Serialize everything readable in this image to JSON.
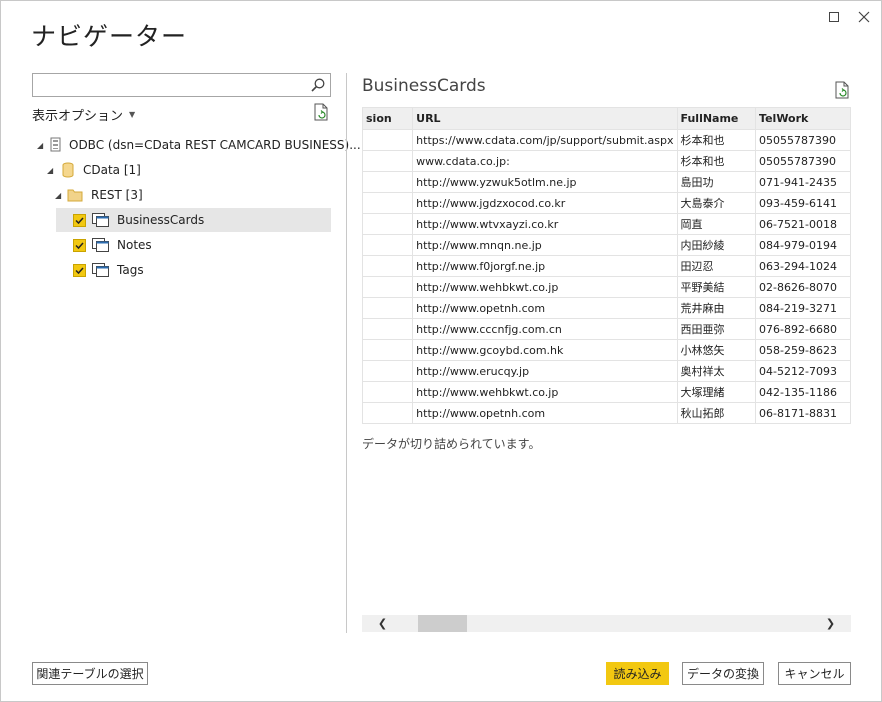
{
  "window": {
    "title": "ナビゲーター",
    "maximize_icon": "maximize-icon",
    "close_icon": "close-icon"
  },
  "left": {
    "search": {
      "value": "",
      "placeholder": ""
    },
    "display_options_label": "表示オプション",
    "tree": [
      {
        "label": "ODBC (dsn=CData REST CAMCARD BUSINESS)...",
        "icon": "database-server-icon",
        "expanded": true
      },
      {
        "label": "CData [1]",
        "icon": "cylinder-database-icon",
        "expanded": true
      },
      {
        "label": "REST [3]",
        "icon": "folder-icon",
        "expanded": true
      },
      {
        "label": "BusinessCards",
        "icon": "table-icon",
        "checked": true,
        "selected": true
      },
      {
        "label": "Notes",
        "icon": "table-icon",
        "checked": true
      },
      {
        "label": "Tags",
        "icon": "table-icon",
        "checked": true
      }
    ]
  },
  "preview": {
    "title": "BusinessCards",
    "columns": [
      "sion",
      "URL",
      "FullName",
      "TelWork"
    ],
    "rows": [
      [
        "",
        "https://www.cdata.com/jp/support/submit.aspx",
        "杉本和也",
        "05055787390"
      ],
      [
        "",
        "www.cdata.co.jp:",
        "杉本和也",
        "05055787390"
      ],
      [
        "",
        "http://www.yzwuk5otlm.ne.jp",
        "島田功",
        "071-941-2435"
      ],
      [
        "",
        "http://www.jgdzxocod.co.kr",
        "大島泰介",
        "093-459-6141"
      ],
      [
        "",
        "http://www.wtvxayzi.co.kr",
        "岡直",
        "06-7521-0018"
      ],
      [
        "",
        "http://www.mnqn.ne.jp",
        "内田紗綾",
        "084-979-0194"
      ],
      [
        "",
        "http://www.f0jorgf.ne.jp",
        "田辺忍",
        "063-294-1024"
      ],
      [
        "",
        "http://www.wehbkwt.co.jp",
        "平野美結",
        "02-8626-8070"
      ],
      [
        "",
        "http://www.opetnh.com",
        "荒井麻由",
        "084-219-3271"
      ],
      [
        "",
        "http://www.cccnfjg.com.cn",
        "西田亜弥",
        "076-892-6680"
      ],
      [
        "",
        "http://www.gcoybd.com.hk",
        "小林悠矢",
        "058-259-8623"
      ],
      [
        "",
        "http://www.erucqy.jp",
        "奥村祥太",
        "04-5212-7093"
      ],
      [
        "",
        "http://www.wehbkwt.co.jp",
        "大塚理緒",
        "042-135-1186"
      ],
      [
        "",
        "http://www.opetnh.com",
        "秋山拓郎",
        "06-8171-8831"
      ]
    ],
    "truncated_message": "データが切り詰められています。"
  },
  "footer": {
    "related_tables": "関連テーブルの選択",
    "load": "読み込み",
    "transform": "データの変換",
    "cancel": "キャンセル"
  },
  "colors": {
    "accent": "#f2c811",
    "border": "#a6a6a6",
    "selected_row": "#e6e6e6"
  }
}
